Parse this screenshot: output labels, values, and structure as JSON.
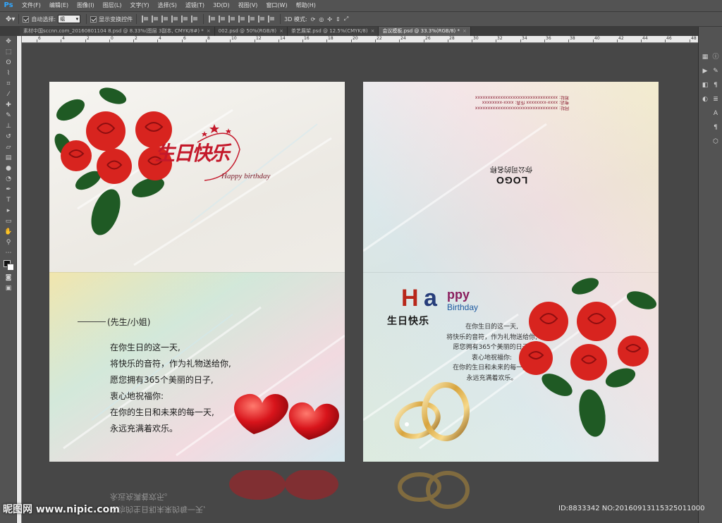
{
  "menubar": {
    "logo": "Ps",
    "items": [
      "文件(F)",
      "编辑(E)",
      "图像(I)",
      "图层(L)",
      "文字(Y)",
      "选择(S)",
      "滤镜(T)",
      "3D(D)",
      "视图(V)",
      "窗口(W)",
      "帮助(H)"
    ]
  },
  "options": {
    "auto_select_label": "自动选择:",
    "auto_select_value": "组",
    "show_transform_label": "显示变换控件",
    "mode_3d_label": "3D 模式:"
  },
  "tabs": [
    {
      "label": "素材中国sccnn.com_20160801104 8.psd @ 8.33%(图层 3副本, CMYK/8#) *",
      "active": false
    },
    {
      "label": "002.psd @ 50%(RGB/8)",
      "active": false
    },
    {
      "label": "茶艺展架.psd @ 12.5%(CMYK/8)",
      "active": false
    },
    {
      "label": "会议模板.psd @ 33.3%(RGB/8) *",
      "active": true
    }
  ],
  "ruler_labels": [
    "6",
    "4",
    "2",
    "0",
    "2",
    "4",
    "6",
    "8",
    "10",
    "12",
    "14",
    "16",
    "18",
    "20",
    "22",
    "24",
    "26",
    "28",
    "30",
    "32",
    "34",
    "36",
    "38",
    "40",
    "42",
    "44",
    "46",
    "48"
  ],
  "left_card": {
    "script_title": "生日快乐",
    "script_subtitle": "Happy birthday",
    "greeting_label": "(先生/小姐)",
    "poem": [
      "在你生日的这一天,",
      "将快乐的音符，作为礼物送给你,",
      "愿您拥有365个美丽的日子,",
      "衷心地祝福你:",
      "在你的生日和未来的每一天,",
      "永远充满着欢乐。"
    ]
  },
  "right_card": {
    "address_lines": [
      "地址:",
      "电话: xxxx-xxxxxxxx  传真: xxxx-xxxxxxxx",
      "网址:"
    ],
    "company_name": "你公司的名称",
    "logo": "LOGO",
    "happy_h": "H",
    "happy_a": "a",
    "happy_ppy": "ppy",
    "happy_birthday": "Birthday",
    "title_cn": "生日快乐",
    "poem": [
      "在你生日的这一天,",
      "将快乐的音符，作为礼物送给你,",
      "愿您拥有365个美丽的日子,",
      "衷心地祝福你:",
      "在你的生日和未来的每一天,",
      "永远充满着欢乐。"
    ]
  },
  "watermark": {
    "left": "昵图网 www.nipic.com",
    "right": "ID:8833342 NO:20160913115325011000"
  },
  "colors": {
    "ui_bg": "#535353",
    "canvas_bg": "#474747",
    "rose_red": "#d8241f",
    "accent_blue": "#31a8ff"
  }
}
